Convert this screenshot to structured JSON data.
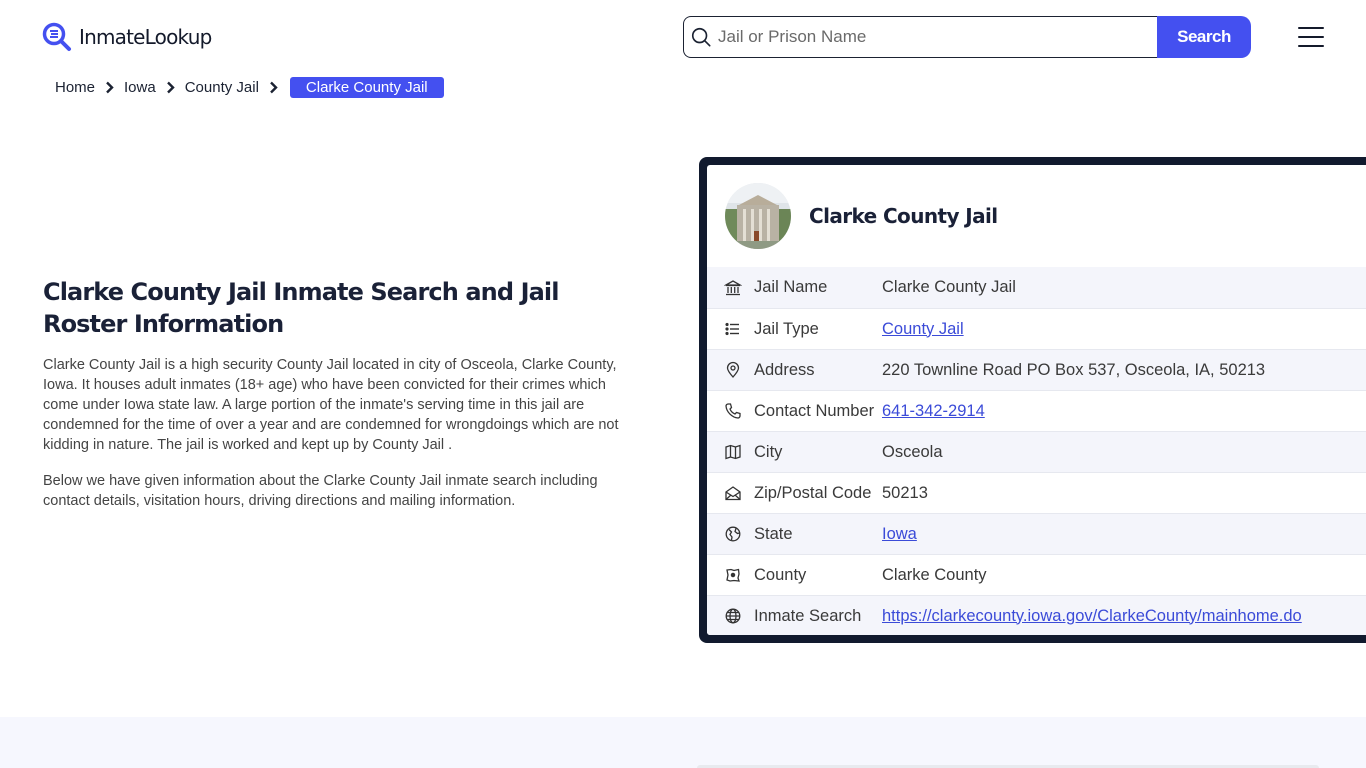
{
  "header": {
    "logo_text": "InmateLookup",
    "logo_icon": "magnifier-logo-icon",
    "search": {
      "placeholder": "Jail or Prison Name",
      "value": "",
      "button_label": "Search"
    },
    "menu_icon": "hamburger-icon"
  },
  "breadcrumb": {
    "items": [
      "Home",
      "Iowa",
      "County Jail"
    ],
    "active": "Clarke County Jail"
  },
  "main": {
    "title": "Clarke County Jail Inmate Search and Jail Roster Information",
    "paragraphs": [
      "Clarke County Jail is a high security County Jail located in city of Osceola, Clarke County, Iowa. It houses adult inmates (18+ age) who have been convicted for their crimes which come under Iowa state law. A large portion of the inmate's serving time in this jail are condemned for the time of over a year and are condemned for wrongdoings which are not kidding in nature. The jail is worked and kept up by County Jail .",
      "Below we have given information about the Clarke County Jail inmate search including contact details, visitation hours, driving directions and mailing information."
    ]
  },
  "card": {
    "title": "Clarke County Jail",
    "image_alt": "courthouse-photo",
    "rows": [
      {
        "icon": "building-columns-icon",
        "label": "Jail Name",
        "value": "Clarke County Jail",
        "link": false
      },
      {
        "icon": "list-icon",
        "label": "Jail Type",
        "value": "County Jail",
        "link": true
      },
      {
        "icon": "map-pin-icon",
        "label": "Address",
        "value": "220 Townline Road PO Box 537, Osceola, IA, 50213",
        "link": false
      },
      {
        "icon": "phone-icon",
        "label": "Contact Number",
        "value": "641-342-2914",
        "link": true
      },
      {
        "icon": "map-icon",
        "label": "City",
        "value": "Osceola",
        "link": false
      },
      {
        "icon": "mail-open-icon",
        "label": "Zip/Postal Code",
        "value": "50213",
        "link": false
      },
      {
        "icon": "globe-pin-icon",
        "label": "State",
        "value": "Iowa",
        "link": true
      },
      {
        "icon": "county-map-icon",
        "label": "County",
        "value": "Clarke County",
        "link": false
      },
      {
        "icon": "globe-icon",
        "label": "Inmate Search",
        "value": "https://clarkecounty.iowa.gov/ClarkeCounty/mainhome.do",
        "link": true
      }
    ]
  },
  "colors": {
    "accent": "#4450f0",
    "card_border": "#111a2e",
    "link": "#3b4bd8",
    "row_alt": "#f4f5fb",
    "bottom_band": "#f6f7fe"
  }
}
